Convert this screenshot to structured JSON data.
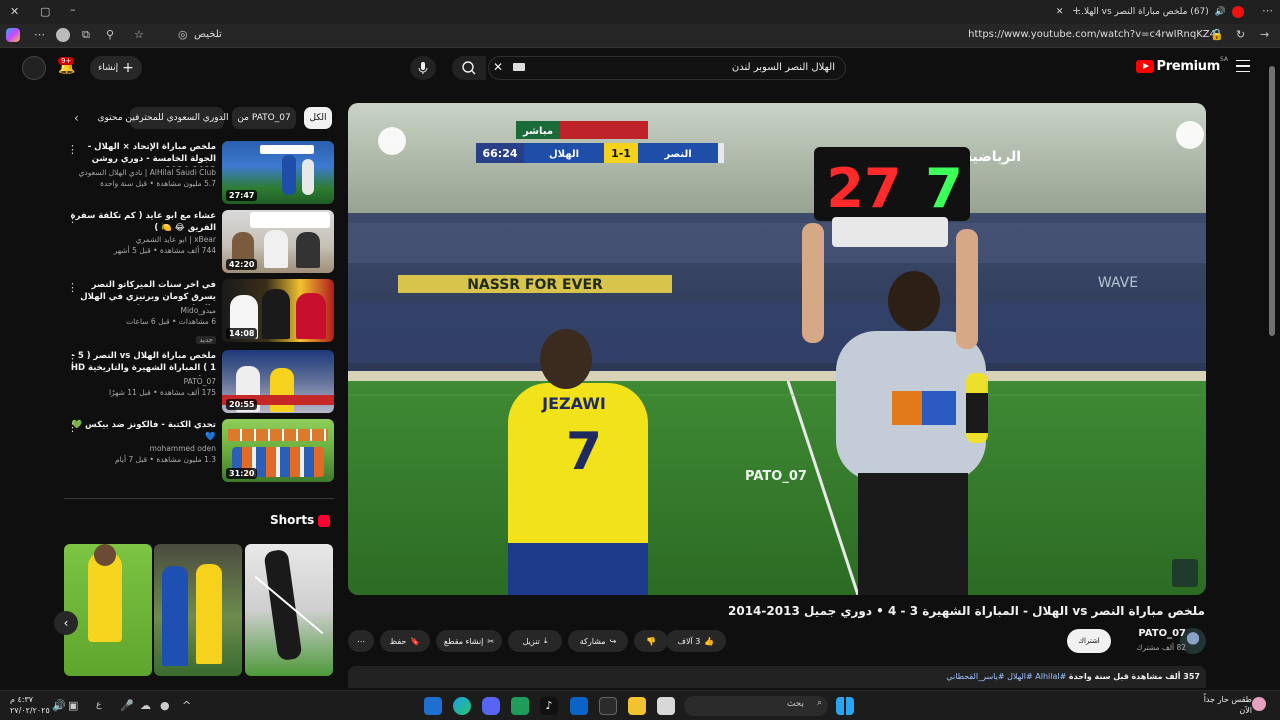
{
  "browser": {
    "tab_title": "(67) ملخص مباراة النصر vs الهلا...",
    "url": "https://www.youtube.com/watch?v=c4rwIRnqKZ4",
    "summarize_label": "تلخيص"
  },
  "header": {
    "search_query": "الهلال النصر السوبر لندن",
    "create_label": "إنشاء",
    "logo_text": "Premium",
    "country_code": "SA",
    "notif_count": "9+"
  },
  "chips": [
    "الكل",
    "من PATO_07",
    "الدوري السعودي للمحترفين",
    "محتوى"
  ],
  "related": [
    {
      "title": "ملخص مباراة الإتحاد × الهلال - الجولة الخامسة - دوري روشن 2023-2024",
      "channel": "AlHilal Saudi Club | نادي الهلال السعودي",
      "meta": "5.7 مليون مشاهدة • قبل سنة واحدة",
      "duration": "27:47"
    },
    {
      "title": "عشاء مع ابو عايد ( كم تكلفة سفرة الفريق 😂 🍋 )",
      "channel": "xBear | ابو عايد الشمري",
      "meta": "744 ألف مشاهدة • قبل 5 أشهر",
      "duration": "42:20"
    },
    {
      "title": "في اخر سنات الميركاتو النصر يسرق كومان وبرنيزي في الهلال والميلان يسرق مهاجم ...",
      "channel": "ميدو_Mido",
      "meta": "6 مشاهدات • قبل 6 ساعات",
      "badge": "جديد",
      "duration": "14:08"
    },
    {
      "title": "ملخص مباراة الهلال vs النصر ( 5 - 1 ) المباراة الشهيرة والتاريخية HD - تعليق ...",
      "channel": "PATO_07",
      "meta": "175 ألف مشاهدة • قبل 11 شهرًا",
      "duration": "20:55"
    },
    {
      "title": "تحدي الكتبة - فالكونز ضد بيكس 💚 💙",
      "channel": "mohammed oden",
      "meta": "1.3 مليون مشاهدة • قبل 7 أيام",
      "duration": "31:20"
    }
  ],
  "shorts": {
    "title": "Shorts"
  },
  "player": {
    "score_home": "النصر",
    "score_away": "الهلال",
    "score": "1-1",
    "clock": "66:24",
    "live_label": "مباشر",
    "channel_bug": "الرياضية",
    "board_out": "27",
    "board_in": "7",
    "banner": "NASSR FOR EVER",
    "wave_text": "WAVE",
    "player_name": "JEZAWI",
    "player_number": "7",
    "watermark": "PATO_07"
  },
  "video": {
    "title": "ملخص مباراة النصر vs الهلال - المباراة الشهيرة 3 - 4 • دوري جميل 2013-2014",
    "channel": "PATO_07",
    "subs": "82 ألف مشترك",
    "subscribe_label": "اشتراك",
    "likes": "3 آلاف",
    "share": "مشاركة",
    "download": "تنزيل",
    "clip": "إنشاء مقطع",
    "save": "حفظ",
    "desc_views": "357 ألف مشاهدة",
    "desc_time": "قبل سنة واحدة",
    "desc_tags": "#Alhilal #الهلال #ياسر_القحطاني"
  },
  "taskbar": {
    "search_label": "بحث",
    "time": "٤:٣٧ م",
    "date": "٢٧/٠٢/٢٠٢٥",
    "weather": "طقس حار جداً",
    "weather_sub": "الآن"
  }
}
